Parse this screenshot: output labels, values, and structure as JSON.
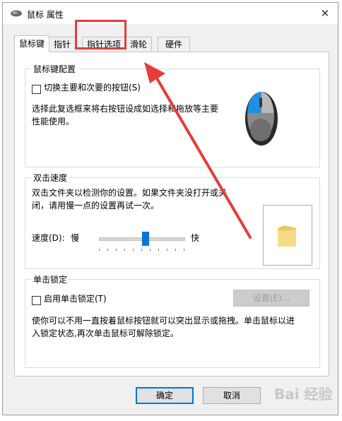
{
  "window": {
    "title": "鼠标 属性",
    "close_label": "✕"
  },
  "tabs": [
    {
      "label": "鼠标键",
      "active": true
    },
    {
      "label": "指针",
      "active": false
    },
    {
      "label": "指针选项",
      "active": false
    },
    {
      "label": "滑轮",
      "active": false
    },
    {
      "label": "硬件",
      "active": false
    }
  ],
  "button_config": {
    "group_title": "鼠标键配置",
    "swap_checkbox_label": "切换主要和次要的按钮(S)",
    "swap_checked": false,
    "description_line1": "选择此复选框来将右按钮设成如选择和拖放等主要",
    "description_line2": "性能使用。"
  },
  "double_click": {
    "group_title": "双击速度",
    "description_line1": "双击文件夹以检测你的设置。如果文件夹没打开或关",
    "description_line2": "闭，请用慢一点的设置再试一次。",
    "speed_label": "速度(D):",
    "slow_label": "慢",
    "fast_label": "快",
    "speed_fraction": 0.55
  },
  "click_lock": {
    "group_title": "单击锁定",
    "checkbox_label": "启用单击锁定(T)",
    "checked": false,
    "settings_button": "设置(E)...",
    "description_line1": "使你可以不用一直按着鼠标按钮就可以突出显示或拖拽。单击鼠标以进",
    "description_line2": "入锁定状态,再次单击鼠标可解除锁定。"
  },
  "footer": {
    "ok_label": "确定",
    "cancel_label": "取消"
  },
  "watermark_text": "Bai 经验",
  "colors": {
    "accent": "#0078d7",
    "annotation": "#e53c3c",
    "mouse_highlight": "#1e90e6"
  }
}
